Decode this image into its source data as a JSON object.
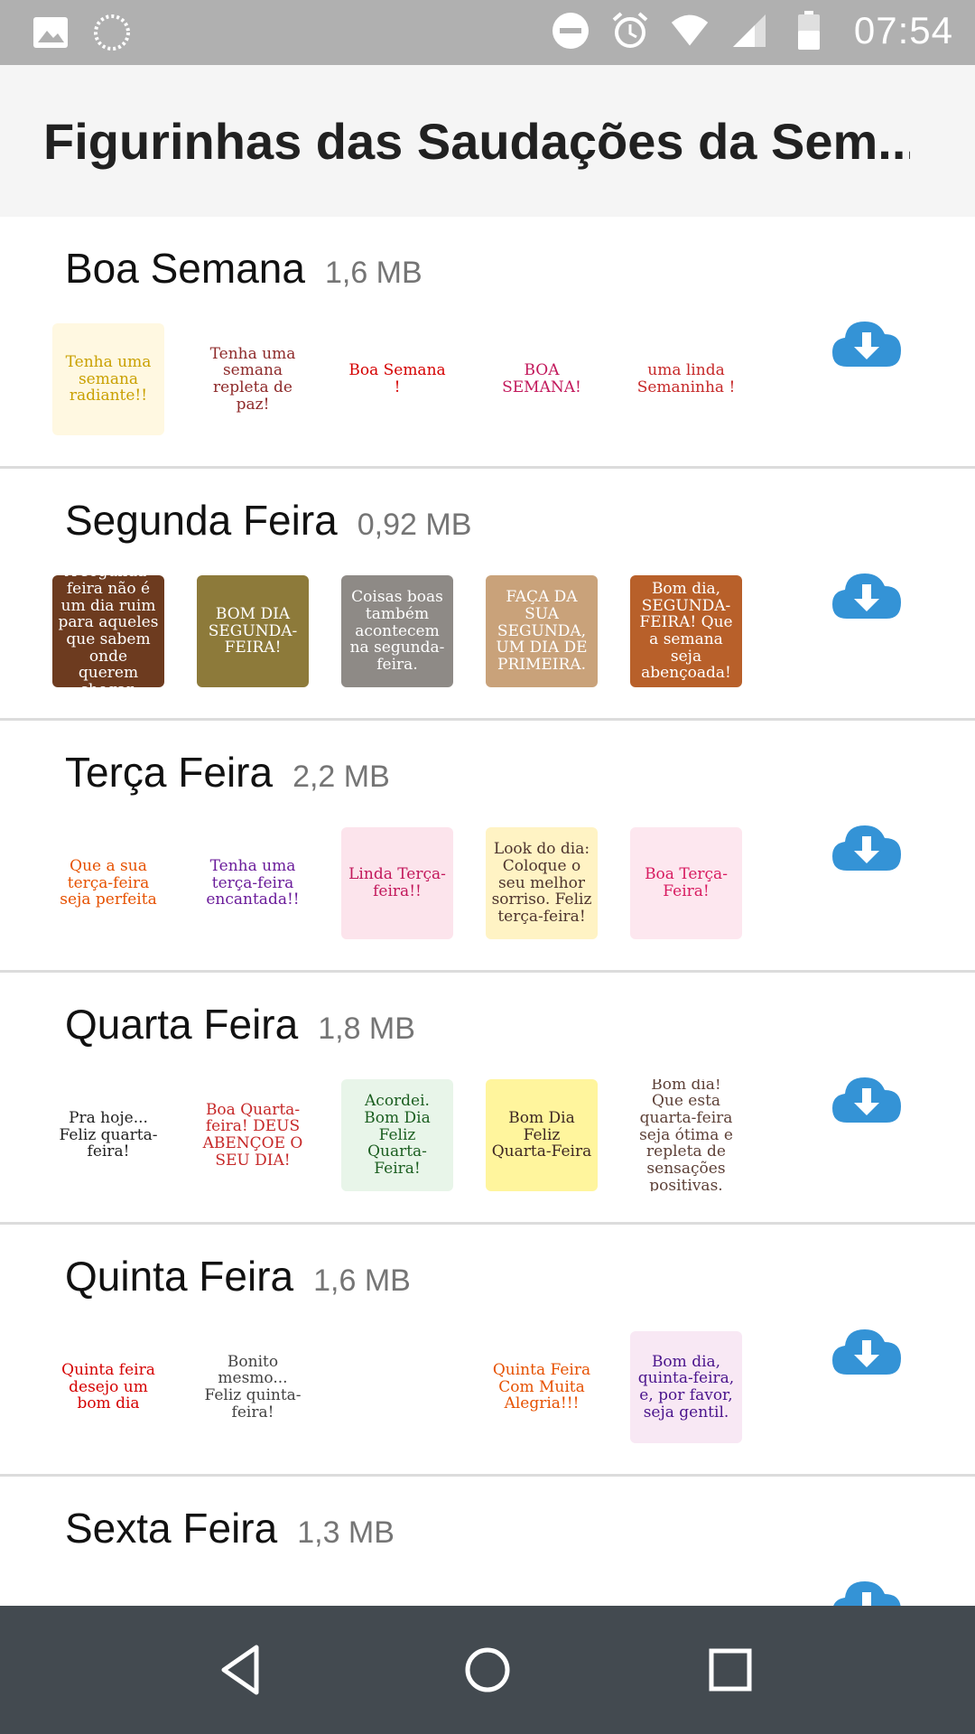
{
  "status_bar": {
    "time": "07:54",
    "left_icons": [
      "image-icon",
      "loading-icon"
    ],
    "right_icons": [
      "do-not-disturb-icon",
      "alarm-icon",
      "wifi-icon",
      "signal-icon",
      "battery-icon"
    ]
  },
  "header": {
    "title": "Figurinhas das Saudações da Sem..."
  },
  "packs": [
    {
      "name": "Boa Semana",
      "size": "1,6 MB",
      "stickers": [
        {
          "text": "Tenha uma semana radiante!!",
          "bg": "#fff8e1",
          "color": "#c9a000"
        },
        {
          "text": "Tenha uma semana repleta de paz!",
          "bg": "#ffffff",
          "color": "#8e2a2a"
        },
        {
          "text": "Boa Semana !",
          "bg": "#ffffff",
          "color": "#d50000"
        },
        {
          "text": "BOA SEMANA!",
          "bg": "#ffffff",
          "color": "#c2185b"
        },
        {
          "text": "uma linda Semaninha !",
          "bg": "#ffffff",
          "color": "#c62828"
        }
      ]
    },
    {
      "name": "Segunda Feira",
      "size": "0,92 MB",
      "stickers": [
        {
          "text": "A segunda-feira não é um dia ruim para aqueles que sabem onde querem chegar.",
          "bg": "#6d3b1f",
          "color": "#ffffff"
        },
        {
          "text": "BOM DIA SEGUNDA-FEIRA!",
          "bg": "#8d7a3a",
          "color": "#ffffff"
        },
        {
          "text": "Coisas boas também acontecem na segunda-feira.",
          "bg": "#8e8a86",
          "color": "#ffffff"
        },
        {
          "text": "FAÇA DA SUA SEGUNDA, UM DIA DE PRIMEIRA.",
          "bg": "#c9a27a",
          "color": "#ffffff"
        },
        {
          "text": "Bom dia, SEGUNDA-FEIRA! Que a semana seja abençoada!",
          "bg": "#b8602a",
          "color": "#ffffff"
        }
      ]
    },
    {
      "name": "Terça Feira",
      "size": "2,2 MB",
      "stickers": [
        {
          "text": "Que a sua terça-feira seja perfeita",
          "bg": "#ffffff",
          "color": "#e65100"
        },
        {
          "text": "Tenha uma terça-feira encantada!!",
          "bg": "#ffffff",
          "color": "#6a1b9a"
        },
        {
          "text": "Linda Terça-feira!!",
          "bg": "#fce4ec",
          "color": "#c2185b"
        },
        {
          "text": "Look do dia: Coloque o seu melhor sorriso. Feliz terça-feira!",
          "bg": "#fff3c4",
          "color": "#4e342e"
        },
        {
          "text": "Boa Terça-Feira!",
          "bg": "#fde7ef",
          "color": "#d81b60"
        }
      ]
    },
    {
      "name": "Quarta Feira",
      "size": "1,8 MB",
      "stickers": [
        {
          "text": "Pra hoje... Feliz quarta-feira!",
          "bg": "#ffffff",
          "color": "#212121"
        },
        {
          "text": "Boa Quarta-feira! DEUS ABENÇOE O SEU DIA!",
          "bg": "#ffffff",
          "color": "#c62828"
        },
        {
          "text": "Acordei. Bom Dia Feliz Quarta-Feira!",
          "bg": "#e8f5e9",
          "color": "#1b5e20"
        },
        {
          "text": "Bom Dia Feliz Quarta-Feira",
          "bg": "#fff59d",
          "color": "#3e2723"
        },
        {
          "text": "Bom dia! Que esta quarta-feira seja ótima e repleta de sensações positivas.",
          "bg": "#ffffff",
          "color": "#5d4037"
        }
      ]
    },
    {
      "name": "Quinta Feira",
      "size": "1,6 MB",
      "stickers": [
        {
          "text": "Quinta feira desejo um bom dia",
          "bg": "#ffffff",
          "color": "#d50000"
        },
        {
          "text": "Bonito mesmo... Feliz quinta-feira!",
          "bg": "#ffffff",
          "color": "#424242"
        },
        {
          "text": "",
          "bg": "#ffffff",
          "color": "#c62828"
        },
        {
          "text": "Quinta Feira Com Muita Alegria!!!",
          "bg": "#ffffff",
          "color": "#e65100"
        },
        {
          "text": "Bom dia, quinta-feira, e, por favor, seja gentil.",
          "bg": "#f8e8f4",
          "color": "#4a148c"
        }
      ]
    },
    {
      "name": "Sexta Feira",
      "size": "1,3 MB",
      "stickers": [
        {
          "text": "",
          "bg": "#ffffff",
          "color": "#c62828"
        },
        {
          "text": "",
          "bg": "#ffffff",
          "color": "#c62828"
        },
        {
          "text": "",
          "bg": "#ffffff",
          "color": "#c62828"
        },
        {
          "text": "",
          "bg": "#ffffff",
          "color": "#c62828"
        },
        {
          "text": "",
          "bg": "#ffffff",
          "color": "#c62828"
        }
      ]
    }
  ],
  "colors": {
    "accent_download": "#3493d6",
    "status_bar": "#b0b0b0",
    "header_bg": "#f5f5f5",
    "nav_bar": "#434a50"
  },
  "nav": {
    "icons": [
      "back-icon",
      "home-icon",
      "recents-icon"
    ]
  }
}
